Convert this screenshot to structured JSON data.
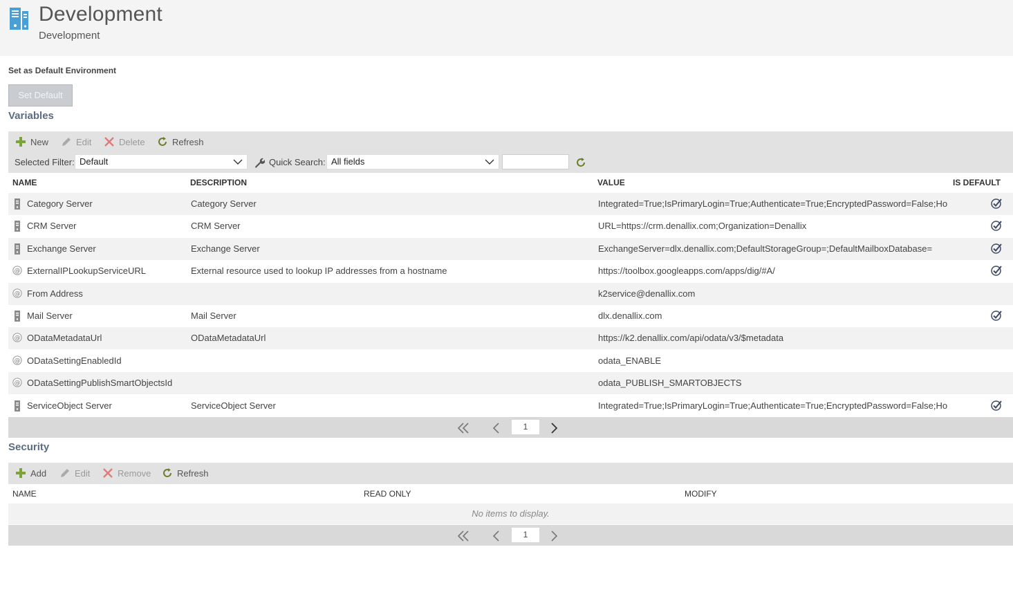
{
  "header": {
    "title": "Development",
    "subtitle": "Development",
    "icon": "environment-server-icon"
  },
  "default_section": {
    "label": "Set as Default Environment",
    "button_label": "Set Default"
  },
  "variables": {
    "title": "Variables",
    "toolbar": {
      "new": "New",
      "edit": "Edit",
      "delete": "Delete",
      "refresh": "Refresh"
    },
    "filter": {
      "selected_filter_label": "Selected Filter:",
      "selected_filter_value": "Default",
      "quick_search_label": "Quick Search:",
      "quick_search_field": "All fields",
      "quick_search_value": ""
    },
    "columns": {
      "name": "NAME",
      "description": "DESCRIPTION",
      "value": "VALUE",
      "is_default": "IS DEFAULT"
    },
    "rows": [
      {
        "type": "server-icon",
        "name": "Category Server",
        "description": "Category Server",
        "value": "Integrated=True;IsPrimaryLogin=True;Authenticate=True;EncryptedPassword=False;Hos...",
        "is_default": true
      },
      {
        "type": "server-icon",
        "name": "CRM Server",
        "description": "CRM Server",
        "value": "URL=https://crm.denallix.com;Organization=Denallix",
        "is_default": true
      },
      {
        "type": "server-icon",
        "name": "Exchange Server",
        "description": "Exchange Server",
        "value": "ExchangeServer=dlx.denallix.com;DefaultStorageGroup=;DefaultMailboxDatabase=",
        "is_default": true
      },
      {
        "type": "at-icon",
        "name": "ExternalIPLookupServiceURL",
        "description": "External resource used to lookup IP addresses from a hostname",
        "value": "https://toolbox.googleapps.com/apps/dig/#A/",
        "is_default": true
      },
      {
        "type": "at-icon",
        "name": "From Address",
        "description": "",
        "value": "k2service@denallix.com",
        "is_default": false
      },
      {
        "type": "server-icon",
        "name": "Mail Server",
        "description": "Mail Server",
        "value": "dlx.denallix.com",
        "is_default": true
      },
      {
        "type": "at-icon",
        "name": "ODataMetadataUrl",
        "description": "ODataMetadataUrl",
        "value": "https://k2.denallix.com/api/odata/v3/$metadata",
        "is_default": false
      },
      {
        "type": "at-icon",
        "name": "ODataSettingEnabledId",
        "description": "",
        "value": "odata_ENABLE",
        "is_default": false
      },
      {
        "type": "at-icon",
        "name": "ODataSettingPublishSmartObjectsId",
        "description": "",
        "value": "odata_PUBLISH_SMARTOBJECTS",
        "is_default": false
      },
      {
        "type": "server-icon",
        "name": "ServiceObject Server",
        "description": "ServiceObject Server",
        "value": "Integrated=True;IsPrimaryLogin=True;Authenticate=True;EncryptedPassword=False;Hos...",
        "is_default": true
      }
    ],
    "pager": {
      "page": "1"
    }
  },
  "security": {
    "title": "Security",
    "toolbar": {
      "add": "Add",
      "edit": "Edit",
      "remove": "Remove",
      "refresh": "Refresh"
    },
    "columns": {
      "name": "NAME",
      "read_only": "READ ONLY",
      "modify": "MODIFY"
    },
    "empty_text": "No items to display.",
    "pager": {
      "page": "1"
    }
  },
  "colors": {
    "accent_blue": "#4a9fd4",
    "add_green": "#7aa33a",
    "delete_red": "#d9534f",
    "toolbar_bg": "#e2e2e2"
  }
}
